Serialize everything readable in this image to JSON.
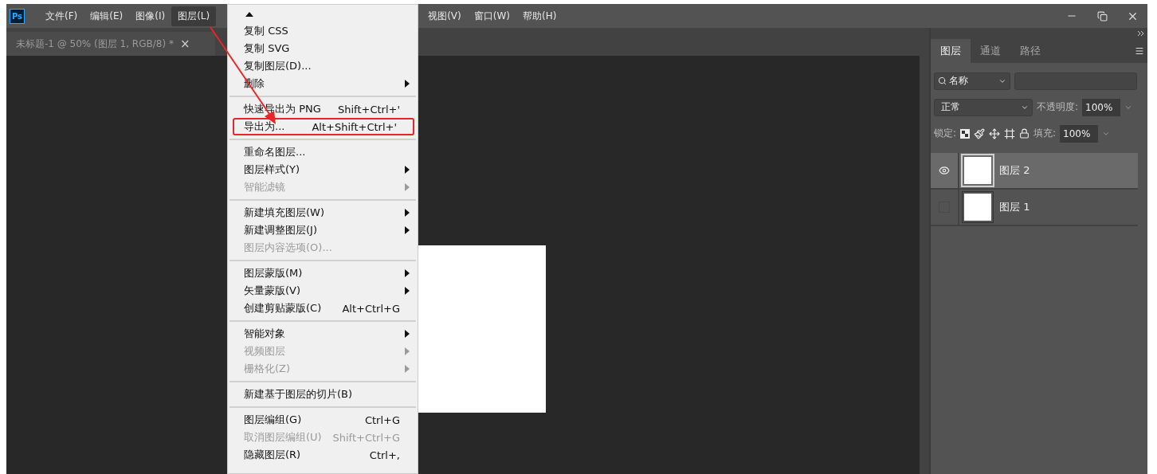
{
  "app_logo": "Ps",
  "menu_bar": [
    {
      "label": "文件(F)",
      "selected": false
    },
    {
      "label": "编辑(E)",
      "selected": false
    },
    {
      "label": "图像(I)",
      "selected": false
    },
    {
      "label": "图层(L)",
      "selected": true
    },
    {
      "label": "视图(V)",
      "selected": false
    },
    {
      "label": "窗口(W)",
      "selected": false
    },
    {
      "label": "帮助(H)",
      "selected": false
    }
  ],
  "document_tab": {
    "title": "未标题-1 @ 50% (图层 1, RGB/8) *",
    "close": "×"
  },
  "layer_menu": [
    {
      "kind": "scroll_up"
    },
    {
      "kind": "item",
      "label": "复制 CSS",
      "disabled": false,
      "submenu": false
    },
    {
      "kind": "item",
      "label": "复制 SVG",
      "disabled": false,
      "submenu": false
    },
    {
      "kind": "item",
      "label": "复制图层(D)...",
      "disabled": false,
      "submenu": false
    },
    {
      "kind": "item",
      "label": "删除",
      "disabled": false,
      "submenu": true
    },
    {
      "kind": "separator"
    },
    {
      "kind": "item",
      "label": "快速导出为 PNG",
      "shortcut": "Shift+Ctrl+'",
      "disabled": false,
      "submenu": false
    },
    {
      "kind": "item",
      "label": "导出为...",
      "shortcut": "Alt+Shift+Ctrl+'",
      "disabled": false,
      "submenu": false,
      "annotated": true
    },
    {
      "kind": "separator"
    },
    {
      "kind": "item",
      "label": "重命名图层...",
      "disabled": false,
      "submenu": false
    },
    {
      "kind": "item",
      "label": "图层样式(Y)",
      "disabled": false,
      "submenu": true
    },
    {
      "kind": "item",
      "label": "智能滤镜",
      "disabled": true,
      "submenu": true
    },
    {
      "kind": "separator"
    },
    {
      "kind": "item",
      "label": "新建填充图层(W)",
      "disabled": false,
      "submenu": true
    },
    {
      "kind": "item",
      "label": "新建调整图层(J)",
      "disabled": false,
      "submenu": true
    },
    {
      "kind": "item",
      "label": "图层内容选项(O)...",
      "disabled": true,
      "submenu": false
    },
    {
      "kind": "separator"
    },
    {
      "kind": "item",
      "label": "图层蒙版(M)",
      "disabled": false,
      "submenu": true
    },
    {
      "kind": "item",
      "label": "矢量蒙版(V)",
      "disabled": false,
      "submenu": true
    },
    {
      "kind": "item",
      "label": "创建剪贴蒙版(C)",
      "shortcut": "Alt+Ctrl+G",
      "disabled": false,
      "submenu": false
    },
    {
      "kind": "separator"
    },
    {
      "kind": "item",
      "label": "智能对象",
      "disabled": false,
      "submenu": true
    },
    {
      "kind": "item",
      "label": "视频图层",
      "disabled": true,
      "submenu": true
    },
    {
      "kind": "item",
      "label": "栅格化(Z)",
      "disabled": true,
      "submenu": true
    },
    {
      "kind": "separator"
    },
    {
      "kind": "item",
      "label": "新建基于图层的切片(B)",
      "disabled": false,
      "submenu": false
    },
    {
      "kind": "separator"
    },
    {
      "kind": "item",
      "label": "图层编组(G)",
      "shortcut": "Ctrl+G",
      "disabled": false,
      "submenu": false
    },
    {
      "kind": "item",
      "label": "取消图层编组(U)",
      "shortcut": "Shift+Ctrl+G",
      "disabled": true,
      "submenu": false
    },
    {
      "kind": "item",
      "label": "隐藏图层(R)",
      "shortcut": "Ctrl+,",
      "disabled": false,
      "submenu": false
    }
  ],
  "panel": {
    "tabs": [
      {
        "label": "图层",
        "selected": true
      },
      {
        "label": "通道",
        "selected": false
      },
      {
        "label": "路径",
        "selected": false
      }
    ],
    "filter": {
      "label": "名称"
    },
    "blend_mode": {
      "value": "正常"
    },
    "opacity": {
      "label": "不透明度:",
      "value": "100%"
    },
    "lock": {
      "label": "锁定:"
    },
    "fill": {
      "label": "填充:",
      "value": "100%"
    },
    "layers": [
      {
        "name": "图层 2",
        "visible": true,
        "selected": true
      },
      {
        "name": "图层 1",
        "visible": false,
        "selected": false
      }
    ]
  }
}
